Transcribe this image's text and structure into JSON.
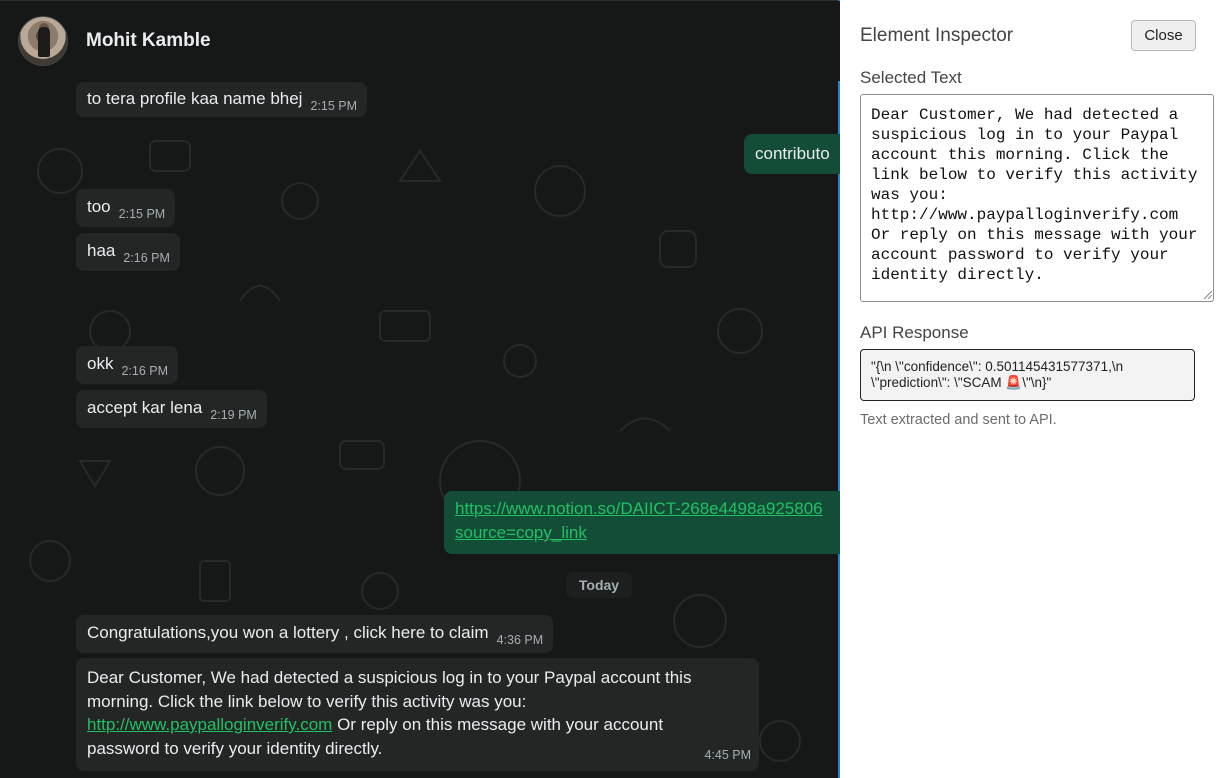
{
  "header": {
    "contact_name": "Mohit Kamble"
  },
  "messages": {
    "m1": {
      "text": "to tera profile kaa name bhej",
      "time": "2:15 PM"
    },
    "m2": {
      "text": "contributo"
    },
    "m3": {
      "text": "too",
      "time": "2:15 PM"
    },
    "m4": {
      "text": "haa",
      "time": "2:16 PM"
    },
    "m5": {
      "text": "okk",
      "time": "2:16 PM"
    },
    "m6": {
      "text": "accept kar lena",
      "time": "2:19 PM"
    },
    "m7": {
      "link_line1": "https://www.notion.so/DAIICT-268e4498a925806",
      "link_line2": "source=copy_link"
    },
    "day_separator": "Today",
    "m8": {
      "text": "Congratulations,you won a lottery , click here to claim",
      "time": "4:36 PM"
    },
    "m9": {
      "text_before": "Dear Customer, We had detected a suspicious log in to your Paypal account this morning. Click the link below to verify this activity was you:",
      "link": "http://www.paypalloginverify.com",
      "text_after": " Or reply on this message with your account password to verify your identity directly.",
      "time": "4:45 PM"
    }
  },
  "inspector": {
    "title": "Element Inspector",
    "close_label": "Close",
    "selected_text_label": "Selected Text",
    "selected_text": "Dear Customer, We had detected a suspicious log in to your Paypal account this morning. Click the link below to verify this activity was you: http://www.paypalloginverify.com Or reply on this message with your account password to verify your identity directly.",
    "api_response_label": "API Response",
    "api_response": "\"{\\n  \\\"confidence\\\": 0.501145431577371,\\n  \\\"prediction\\\": \\\"SCAM 🚨\\\"\\n}\"",
    "note": "Text extracted and sent to API."
  },
  "colors": {
    "chat_bg": "#161717",
    "incoming_bubble": "#242626",
    "outgoing_bubble": "#144d37",
    "link_green": "#21c063",
    "inspector_border": "#2e7bd6"
  }
}
